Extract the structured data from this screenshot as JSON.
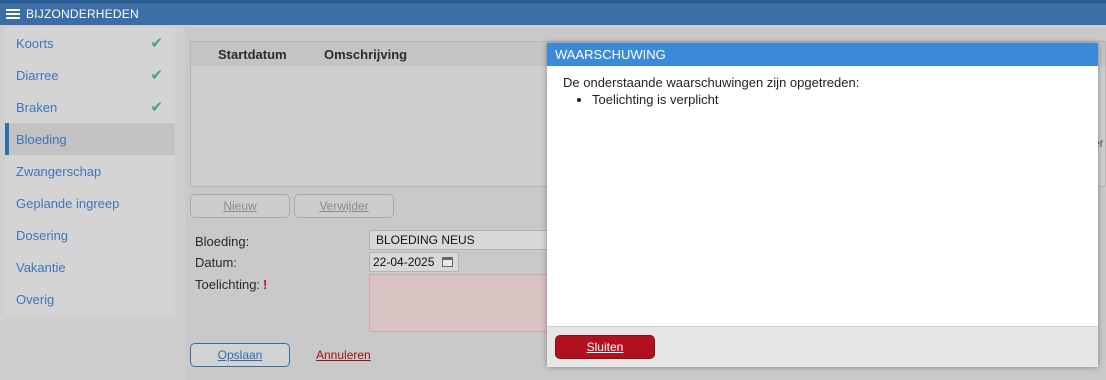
{
  "title": "BIJZONDERHEDEN",
  "sidebar": {
    "items": [
      {
        "label": "Koorts",
        "checked": true
      },
      {
        "label": "Diarree",
        "checked": true
      },
      {
        "label": "Braken",
        "checked": true
      },
      {
        "label": "Bloeding",
        "active": true
      },
      {
        "label": "Zwangerschap"
      },
      {
        "label": "Geplande ingreep"
      },
      {
        "label": "Dosering"
      },
      {
        "label": "Vakantie"
      },
      {
        "label": "Overig"
      }
    ]
  },
  "grid": {
    "columns": [
      "Startdatum",
      "Omschrijving"
    ],
    "partial_right_text": "er"
  },
  "buttons": {
    "new_label": "Nieuw",
    "delete_label": "Verwijder",
    "save_label": "Opslaan",
    "cancel_label": "Annuleren"
  },
  "form": {
    "bloeding_label": "Bloeding:",
    "bloeding_value": "BLOEDING NEUS",
    "datum_label": "Datum:",
    "datum_value": "22-04-2025",
    "toelichting_label": "Toelichting:",
    "required_marker": "!"
  },
  "dialog": {
    "title": "WAARSCHUWING",
    "message": "De onderstaande waarschuwingen zijn opgetreden:",
    "warnings": [
      "Toelichting is verplicht"
    ],
    "close_label": "Sluiten"
  },
  "colors": {
    "titlebar": "#3a6ea5",
    "dialog_header": "#3b8ad9",
    "close_button": "#b0111e",
    "link": "#3a78b8",
    "check": "#3fa86a"
  }
}
